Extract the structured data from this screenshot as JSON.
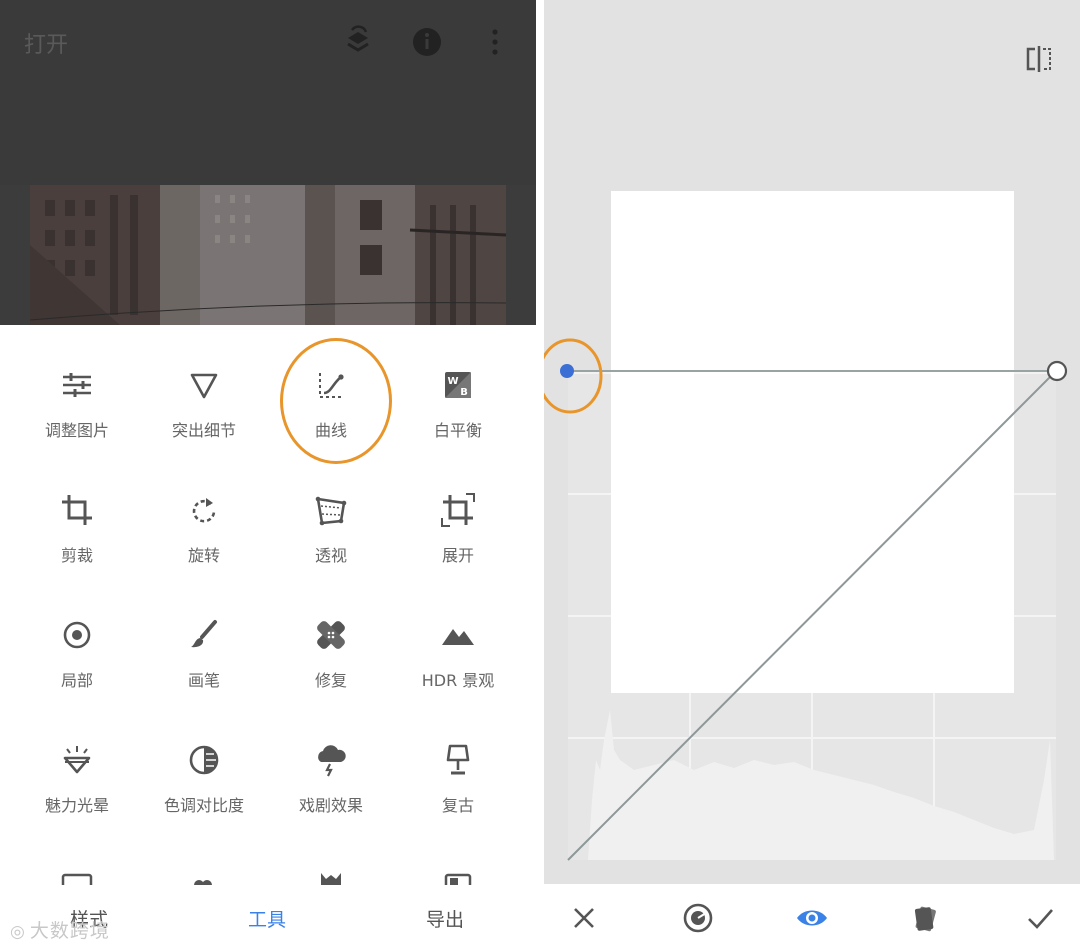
{
  "header": {
    "title": "打开"
  },
  "top_icons": [
    "layers-undo-icon",
    "info-icon",
    "more-vert-icon"
  ],
  "tools": [
    {
      "label": "调整图片",
      "icon": "tune-sliders-icon"
    },
    {
      "label": "突出细节",
      "icon": "details-triangle-icon"
    },
    {
      "label": "曲线",
      "icon": "curves-icon",
      "highlighted": true
    },
    {
      "label": "白平衡",
      "icon": "white-balance-icon"
    },
    {
      "label": "剪裁",
      "icon": "crop-icon"
    },
    {
      "label": "旋转",
      "icon": "rotate-icon"
    },
    {
      "label": "透视",
      "icon": "perspective-icon"
    },
    {
      "label": "展开",
      "icon": "expand-icon"
    },
    {
      "label": "局部",
      "icon": "selective-icon"
    },
    {
      "label": "画笔",
      "icon": "brush-icon"
    },
    {
      "label": "修复",
      "icon": "healing-icon"
    },
    {
      "label": "HDR 景观",
      "icon": "hdr-mountain-icon"
    },
    {
      "label": "魅力光晕",
      "icon": "glamour-glow-icon"
    },
    {
      "label": "色调对比度",
      "icon": "tonal-contrast-icon"
    },
    {
      "label": "戏剧效果",
      "icon": "drama-cloud-icon"
    },
    {
      "label": "复古",
      "icon": "vintage-lamp-icon"
    }
  ],
  "bottom_nav": {
    "styles": "样式",
    "tools": "工具",
    "export": "导出",
    "active": "tools"
  },
  "watermark": "大数跨境",
  "editor": {
    "compare_icon": "compare-split-icon",
    "bottom_actions": [
      "cancel-icon",
      "channel-selector-icon",
      "preview-eye-icon",
      "presets-icon",
      "apply-check-icon"
    ],
    "accent": "#3b82e8",
    "highlight_color": "#e8952b"
  }
}
